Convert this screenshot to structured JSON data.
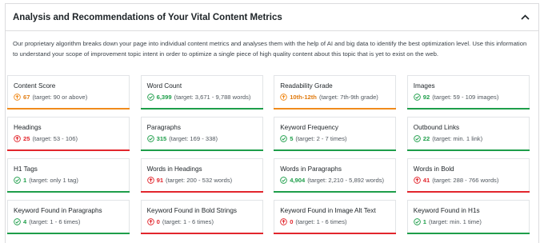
{
  "panel": {
    "title": "Analysis and Recommendations of Your Vital Content Metrics",
    "intro": "Our proprietary algorithm breaks down your page into individual content metrics and analyses them with the help of AI and big data to identify the best optimization level. Use this information to understand your scope of improvement topic intent in order to optimize a single piece of high quality content about this topic that is yet to exist on the web."
  },
  "colors": {
    "good": "#1e9e4a",
    "warn": "#f08b1c",
    "bad": "#e2262d"
  },
  "metrics": [
    {
      "title": "Content Score",
      "value": "67",
      "target": "(target: 90 or above)",
      "status": "orange",
      "icon": "arrow-up-circle-icon"
    },
    {
      "title": "Word Count",
      "value": "6,399",
      "target": "(target: 3,671 - 9,788 words)",
      "status": "green",
      "icon": "check-circle-icon"
    },
    {
      "title": "Readability Grade",
      "value": "10th-12th",
      "target": "(target: 7th-9th grade)",
      "status": "orange",
      "icon": "arrow-up-circle-icon"
    },
    {
      "title": "Images",
      "value": "92",
      "target": "(target: 59 - 109 images)",
      "status": "green",
      "icon": "check-circle-icon"
    },
    {
      "title": "Headings",
      "value": "25",
      "target": "(target: 53 - 106)",
      "status": "red",
      "icon": "arrow-up-circle-icon"
    },
    {
      "title": "Paragraphs",
      "value": "315",
      "target": "(target: 169 - 338)",
      "status": "green",
      "icon": "check-circle-icon"
    },
    {
      "title": "Keyword Frequency",
      "value": "5",
      "target": "(target: 2 - 7 times)",
      "status": "green",
      "icon": "check-circle-icon"
    },
    {
      "title": "Outbound Links",
      "value": "22",
      "target": "(target: min. 1 link)",
      "status": "green",
      "icon": "check-circle-icon"
    },
    {
      "title": "H1 Tags",
      "value": "1",
      "target": "(target: only 1 tag)",
      "status": "green",
      "icon": "check-circle-icon"
    },
    {
      "title": "Words in Headings",
      "value": "91",
      "target": "(target: 200 - 532 words)",
      "status": "red",
      "icon": "arrow-up-circle-icon"
    },
    {
      "title": "Words in Paragraphs",
      "value": "4,904",
      "target": "(target: 2,210 - 5,892 words)",
      "status": "green",
      "icon": "check-circle-icon"
    },
    {
      "title": "Words in Bold",
      "value": "41",
      "target": "(target: 288 - 766 words)",
      "status": "red",
      "icon": "arrow-up-circle-icon"
    },
    {
      "title": "Keyword Found in Paragraphs",
      "value": "4",
      "target": "(target: 1 - 6 times)",
      "status": "green",
      "icon": "check-circle-icon"
    },
    {
      "title": "Keyword Found in Bold Strings",
      "value": "0",
      "target": "(target: 1 - 6 times)",
      "status": "red",
      "icon": "arrow-up-circle-icon"
    },
    {
      "title": "Keyword Found in Image Alt Text",
      "value": "0",
      "target": "(target: 1 - 6 times)",
      "status": "red",
      "icon": "arrow-up-circle-icon"
    },
    {
      "title": "Keyword Found in H1s",
      "value": "1",
      "target": "(target: min. 1 time)",
      "status": "green",
      "icon": "check-circle-icon"
    }
  ]
}
